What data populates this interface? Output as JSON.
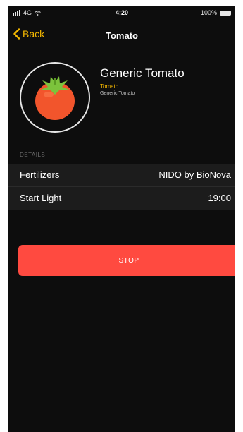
{
  "status_bar": {
    "carrier": "4G",
    "time": "4:20",
    "battery": "100%"
  },
  "nav": {
    "back_label": "Back",
    "title": "Tomato"
  },
  "plant": {
    "name": "Generic Tomato",
    "type": "Tomato",
    "subtitle": "Generic Tomato",
    "icon": "tomato-icon"
  },
  "details": {
    "header": "DETAILS",
    "rows": [
      {
        "label": "Fertilizers",
        "value": "NIDO by BioNova"
      },
      {
        "label": "Start Light",
        "value": "19:00"
      }
    ]
  },
  "actions": {
    "stop_label": "STOP"
  },
  "colors": {
    "accent": "#f5b800",
    "stop": "#ff4a40",
    "background": "#0d0d0d",
    "row_background": "#1c1c1c"
  }
}
